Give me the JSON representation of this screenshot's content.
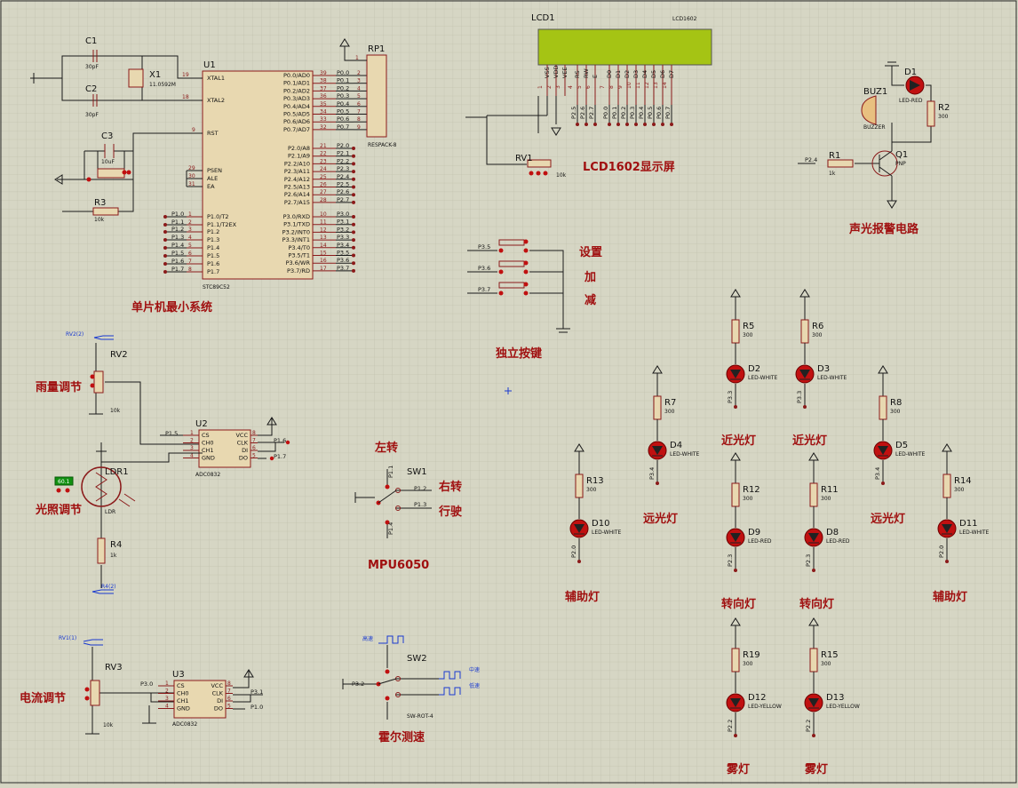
{
  "schematic": {
    "labels": {
      "mcu_system": "单片机最小系统",
      "lcd_screen": "LCD1602显示屏",
      "alarm": "声光报警电路",
      "buttons": "独立按键",
      "set": "设置",
      "add": "加",
      "sub": "减",
      "rain": "雨量调节",
      "light": "光照调节",
      "current": "电流调节",
      "turn_left": "左转",
      "turn_right": "右转",
      "drive": "行驶",
      "mpu": "MPU6050",
      "hall": "霍尔测速",
      "high_beam_1": "远光灯",
      "high_beam_2": "远光灯",
      "low_beam_1": "近光灯",
      "low_beam_2": "近光灯",
      "turn_1": "转向灯",
      "turn_2": "转向灯",
      "aux_1": "辅助灯",
      "aux_2": "辅助灯",
      "fog_1": "雾灯",
      "fog_2": "雾灯"
    },
    "u1": {
      "ref": "U1",
      "part": "STC89C52",
      "left_pins": [
        {
          "num": "19",
          "name": "XTAL1"
        },
        {
          "num": "18",
          "name": "XTAL2"
        },
        {
          "num": "9",
          "name": "RST"
        },
        {
          "num": "29",
          "name": "PSEN"
        },
        {
          "num": "30",
          "name": "ALE"
        },
        {
          "num": "31",
          "name": "EA"
        },
        {
          "num": "1",
          "name": "P1.0/T2"
        },
        {
          "num": "2",
          "name": "P1.1/T2EX"
        },
        {
          "num": "3",
          "name": "P1.2"
        },
        {
          "num": "4",
          "name": "P1.3"
        },
        {
          "num": "5",
          "name": "P1.4"
        },
        {
          "num": "6",
          "name": "P1.5"
        },
        {
          "num": "7",
          "name": "P1.6"
        },
        {
          "num": "8",
          "name": "P1.7"
        }
      ],
      "left_nets": [
        "P1.0",
        "P1.1",
        "P1.2",
        "P1.3",
        "P1.4",
        "P1.5",
        "P1.6",
        "P1.7"
      ],
      "right_pins": [
        {
          "num": "39",
          "name": "P0.0/AD0",
          "net": "P0.0"
        },
        {
          "num": "38",
          "name": "P0.1/AD1",
          "net": "P0.1"
        },
        {
          "num": "37",
          "name": "P0.2/AD2",
          "net": "P0.2"
        },
        {
          "num": "36",
          "name": "P0.3/AD3",
          "net": "P0.3"
        },
        {
          "num": "35",
          "name": "P0.4/AD4",
          "net": "P0.4"
        },
        {
          "num": "34",
          "name": "P0.5/AD5",
          "net": "P0.5"
        },
        {
          "num": "33",
          "name": "P0.6/AD6",
          "net": "P0.6"
        },
        {
          "num": "32",
          "name": "P0.7/AD7",
          "net": "P0.7"
        },
        {
          "num": "21",
          "name": "P2.0/A8",
          "net": "P2.0"
        },
        {
          "num": "22",
          "name": "P2.1/A9",
          "net": "P2.1"
        },
        {
          "num": "23",
          "name": "P2.2/A10",
          "net": "P2.2"
        },
        {
          "num": "24",
          "name": "P2.3/A11",
          "net": "P2.3"
        },
        {
          "num": "25",
          "name": "P2.4/A12",
          "net": "P2.4"
        },
        {
          "num": "26",
          "name": "P2.5/A13",
          "net": "P2.5"
        },
        {
          "num": "27",
          "name": "P2.6/A14",
          "net": "P2.6"
        },
        {
          "num": "28",
          "name": "P2.7/A15",
          "net": "P2.7"
        },
        {
          "num": "10",
          "name": "P3.0/RXD",
          "net": "P3.0"
        },
        {
          "num": "11",
          "name": "P3.1/TXD",
          "net": "P3.1"
        },
        {
          "num": "12",
          "name": "P3.2/INT0",
          "net": "P3.2"
        },
        {
          "num": "13",
          "name": "P3.3/INT1",
          "net": "P3.3"
        },
        {
          "num": "14",
          "name": "P3.4/T0",
          "net": "P3.4"
        },
        {
          "num": "15",
          "name": "P3.5/T1",
          "net": "P3.5"
        },
        {
          "num": "16",
          "name": "P3.6/WR",
          "net": "P3.6"
        },
        {
          "num": "17",
          "name": "P3.7/RD",
          "net": "P3.7"
        }
      ],
      "rp1_ref": "RP1",
      "rp1_part": "RESPACK-8",
      "rp1_pin1": "1",
      "x1_ref": "X1",
      "x1_val": "11.0592M",
      "c1_ref": "C1",
      "c1_val": "30pF",
      "c2_ref": "C2",
      "c2_val": "30pF",
      "c3_ref": "C3",
      "c3_val": "10uF",
      "r3_ref": "R3",
      "r3_val": "10k"
    },
    "lcd": {
      "ref": "LCD1",
      "part": "LCD1602",
      "pins": [
        "VSS",
        "VDD",
        "VEE",
        "RS",
        "RW",
        "E",
        "D0",
        "D1",
        "D2",
        "D3",
        "D4",
        "D5",
        "D6",
        "D7"
      ],
      "pin_nums": [
        "1",
        "2",
        "3",
        "4",
        "5",
        "6",
        "7",
        "8",
        "9",
        "10",
        "11",
        "12",
        "13",
        "14"
      ],
      "nets": [
        "P2.5",
        "P2.6",
        "P2.7",
        "P0.0",
        "P0.1",
        "P0.2",
        "P0.3",
        "P0.4",
        "P0.5",
        "P0.6",
        "P0.7"
      ],
      "rv1_ref": "RV1",
      "rv1_val": "10k"
    },
    "alarm": {
      "d1_ref": "D1",
      "d1_val": "LED-RED",
      "buz_ref": "BUZ1",
      "buz_val": "BUZZER",
      "r2_ref": "R2",
      "r2_val": "300",
      "q1_ref": "Q1",
      "q1_val": "PNP",
      "r1_ref": "R1",
      "r1_val": "1k",
      "net": "P2.4"
    },
    "keys": {
      "nets": [
        "P3.5",
        "P3.6",
        "P3.7"
      ]
    },
    "rain": {
      "rv_ref": "RV2",
      "rv_val": "10k",
      "probe": "RV2(2)",
      "u_ref": "U2",
      "u_part": "ADC0832",
      "net_cs": "P1.5",
      "net_clk": "P1.6",
      "net_do": "P1.7"
    },
    "light": {
      "ldr_ref": "LDR1",
      "ldr_val": "LDR",
      "reading": "60.1",
      "r4_ref": "R4",
      "r4_val": "1k",
      "probe": "R4(2)"
    },
    "current": {
      "rv_ref": "RV3",
      "rv_val": "10k",
      "probe": "RV1(1)",
      "u_ref": "U3",
      "u_part": "ADC0832",
      "net_cs": "P3.0",
      "net_clk": "P3.1",
      "net_do": "P1.0"
    },
    "adc_pins": {
      "left": [
        {
          "num": "1",
          "name": "CS"
        },
        {
          "num": "2",
          "name": "CH0"
        },
        {
          "num": "3",
          "name": "CH1"
        },
        {
          "num": "4",
          "name": "GND"
        }
      ],
      "right": [
        {
          "num": "8",
          "name": "VCC"
        },
        {
          "num": "7",
          "name": "CLK"
        },
        {
          "num": "6",
          "name": "DI"
        },
        {
          "num": "5",
          "name": "DO"
        }
      ]
    },
    "sw1": {
      "ref": "SW1",
      "nets": [
        "P1.1",
        "P1.2",
        "P1.3",
        "P1.4"
      ]
    },
    "sw2": {
      "ref": "SW2",
      "part": "SW-ROT-4",
      "net": "P3.2",
      "sig_high": "高速",
      "sig_mid": "中速",
      "sig_low": "低速"
    },
    "leds": {
      "r5": "R5",
      "r6": "R6",
      "r7": "R7",
      "r8": "R8",
      "r11": "R11",
      "r12": "R12",
      "r13": "R13",
      "r14": "R14",
      "r15": "R15",
      "r19": "R19",
      "rval": "300",
      "d2": "D2",
      "d3": "D3",
      "d4": "D4",
      "d5": "D5",
      "d8": "D8",
      "d9": "D9",
      "d10": "D10",
      "d11": "D11",
      "d12": "D12",
      "d13": "D13",
      "white": "LED-WHITE",
      "red": "LED-RED",
      "yellow": "LED-YELLOW",
      "net_p33": "P3.3",
      "net_p34": "P3.4",
      "net_p23": "P2.3",
      "net_p20": "P2.0",
      "net_p22": "P2.2"
    },
    "colors": {
      "grid_bg": "#d6d6c4",
      "component": "#8b1a1a",
      "label_red": "#a01010",
      "lcd_green": "#a5c414"
    }
  }
}
